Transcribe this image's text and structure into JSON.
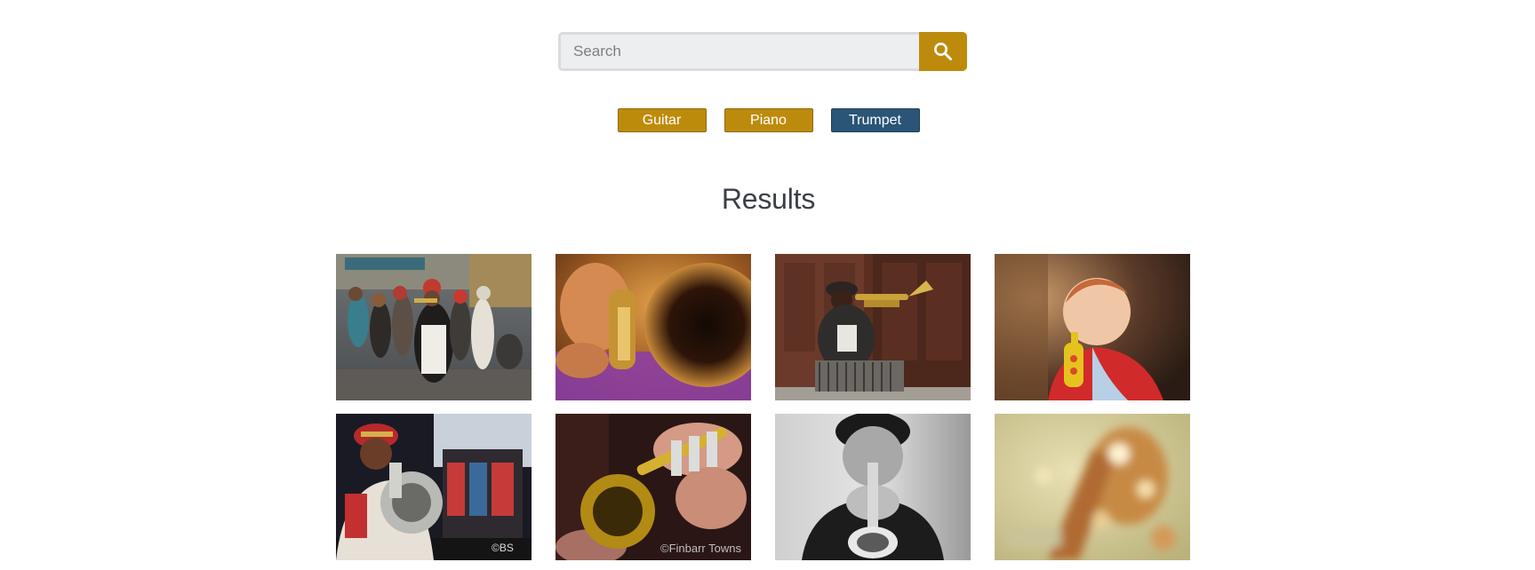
{
  "search": {
    "placeholder": "Search",
    "value": "",
    "button_icon": "search-icon",
    "accent": "#bd8b0c"
  },
  "tags": [
    {
      "label": "Guitar",
      "color": "#bd8b0c",
      "active": false
    },
    {
      "label": "Piano",
      "color": "#bd8b0c",
      "active": false
    },
    {
      "label": "Trumpet",
      "color": "#2a5577",
      "active": true
    }
  ],
  "results": {
    "title": "Results",
    "images": [
      {
        "name": "street-band-photo"
      },
      {
        "name": "trumpet-closeup-purple-photo"
      },
      {
        "name": "man-with-trumpet-doorway-photo"
      },
      {
        "name": "toddler-toy-trumpet-photo"
      },
      {
        "name": "marching-band-tuba-photo"
      },
      {
        "name": "trumpet-hands-closeup-photo"
      },
      {
        "name": "bw-boy-playing-trumpet-photo"
      },
      {
        "name": "blurry-brass-bokeh-photo"
      }
    ],
    "watermarks": [
      "©BS",
      "©Finbarr Towns"
    ]
  }
}
